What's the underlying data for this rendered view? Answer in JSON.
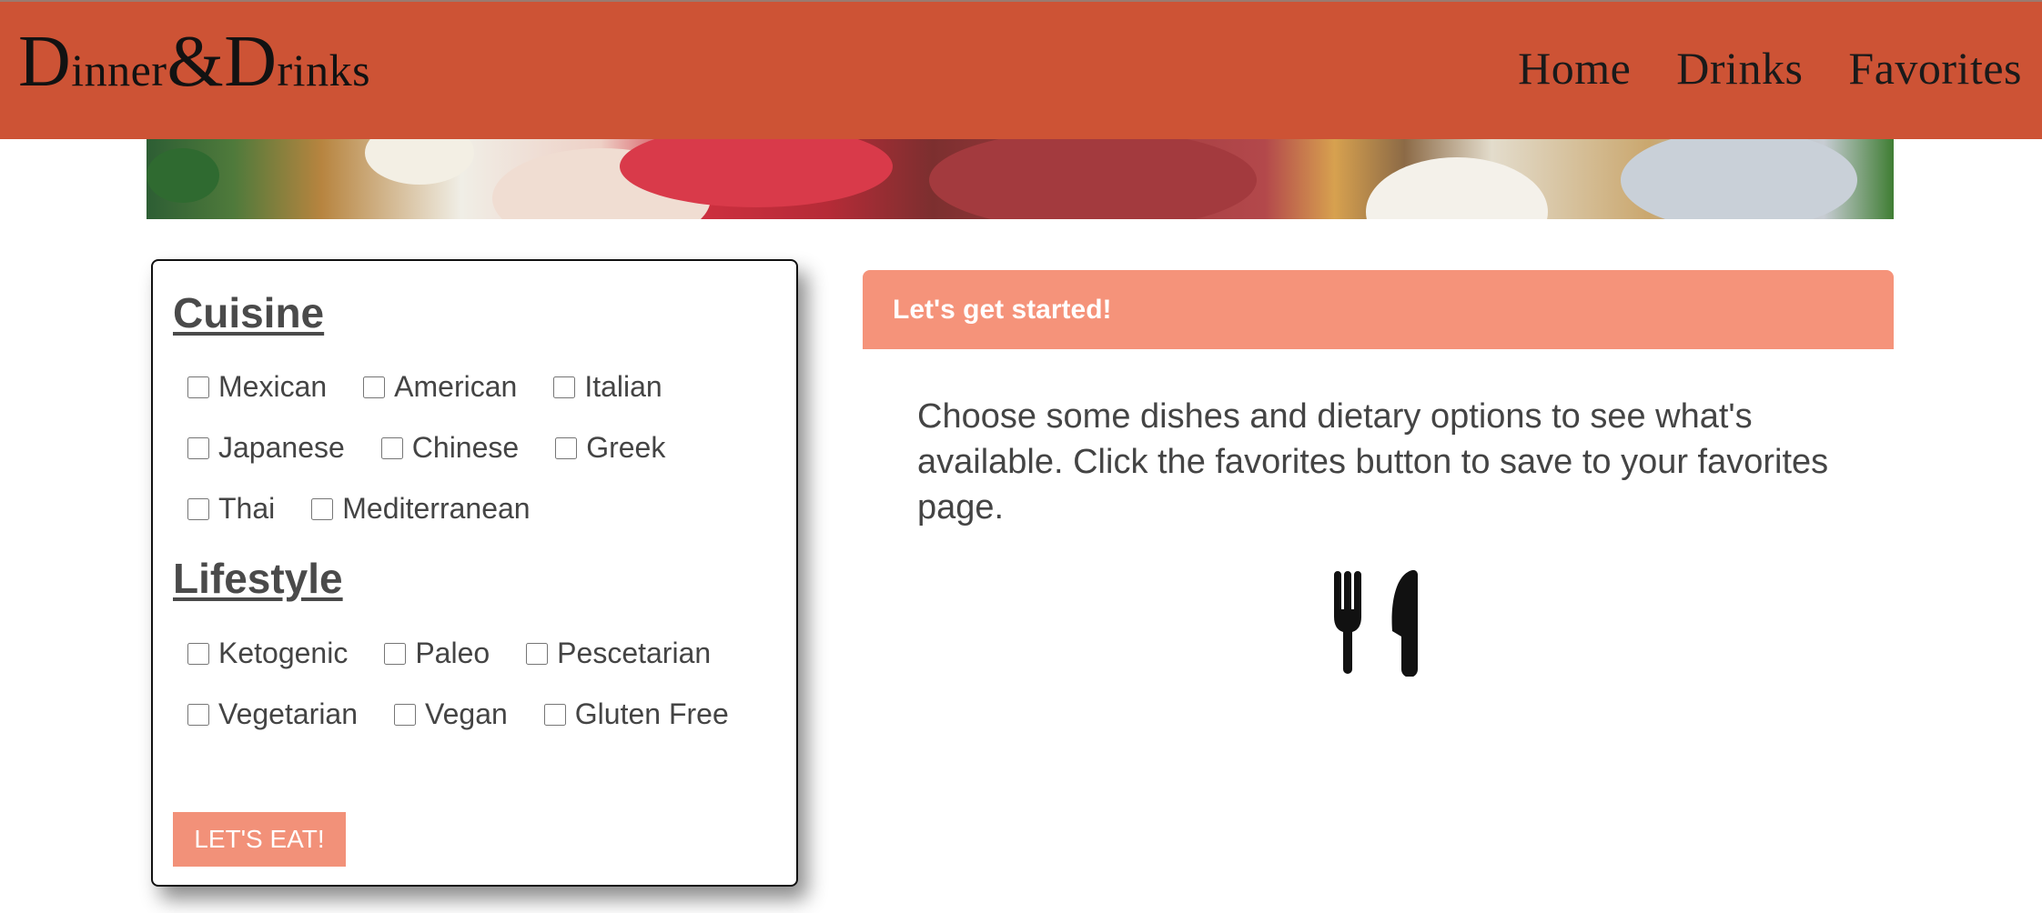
{
  "brand": {
    "first_cap": "D",
    "first_rest": "inner",
    "amp": "&",
    "second_cap": "D",
    "second_rest": "rinks"
  },
  "nav": {
    "items": [
      "Home",
      "Drinks",
      "Favorites"
    ]
  },
  "hero": {
    "icon": "food-ingredients-banner"
  },
  "filters": {
    "cuisine_title": "Cuisine",
    "cuisine_options": [
      "Mexican",
      "American",
      "Italian",
      "Japanese",
      "Chinese",
      "Greek",
      "Thai",
      "Mediterranean"
    ],
    "lifestyle_title": "Lifestyle",
    "lifestyle_options": [
      "Ketogenic",
      "Paleo",
      "Pescetarian",
      "Vegetarian",
      "Vegan",
      "Gluten Free"
    ],
    "submit_label": "LET'S EAT!"
  },
  "results": {
    "header": "Let's get started!",
    "intro": "Choose some dishes and dietary options to see what's available. Click the favorites button to save to your favorites page.",
    "icon": "utensils-icon"
  },
  "colors": {
    "navbar": "#cd5335",
    "accent": "#f5937a",
    "button": "#f29179",
    "text": "#444444"
  }
}
